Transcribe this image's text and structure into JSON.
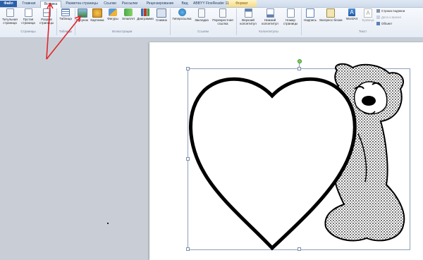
{
  "tabs": [
    "Файл",
    "Главная",
    "Вставка",
    "Разметка страницы",
    "Ссылки",
    "Рассылки",
    "Рецензирование",
    "Вид",
    "ABBYY FineReader 11",
    "Формат"
  ],
  "active_tab": "Вставка",
  "groups": [
    "Страницы",
    "Таблицы",
    "Иллюстрации",
    "Ссылки",
    "Колонтитулы",
    "Текст"
  ],
  "buttons": {
    "title_page": "Титульная\nстраница",
    "blank_page": "Пустая\nстраница",
    "page_break": "Разрыв\nстраницы",
    "table": "Таблица",
    "picture": "Рисунок",
    "clipart": "Картинка",
    "shapes": "Фигуры",
    "smartart": "SmartArt",
    "chart": "Диаграмма",
    "screenshot": "Снимок",
    "hyperlink": "Гиперссылка",
    "bookmark": "Закладка",
    "crossref": "Перекрестная\nссылка",
    "header": "Верхний\nколонтитул",
    "footer": "Нижний\nколонтитул",
    "page_number": "Номер\nстраницы",
    "textbox": "Надпись",
    "quickparts": "Экспресс-блоки",
    "wordart": "WordArt",
    "dropcap": "Буквица"
  },
  "small_buttons": {
    "signature_line": "Строка подписи",
    "date_time": "Дата и время",
    "object": "Объект"
  },
  "colors": {
    "file_tab": "#2a5fa9",
    "arrow": "#e0262a",
    "rotation_handle": "#7bd35a"
  }
}
